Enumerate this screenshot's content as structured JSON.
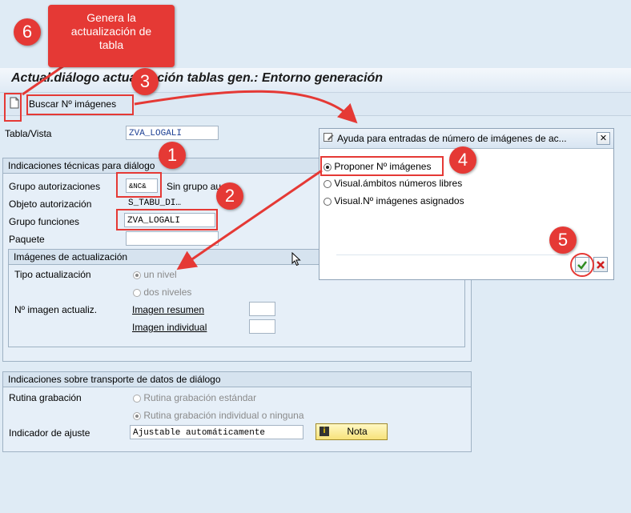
{
  "title": "Actual.diálogo actualización tablas gen.: Entorno generación",
  "toolbar": {
    "search_label": "Buscar Nº imágenes"
  },
  "table_view": {
    "label": "Tabla/Vista",
    "value": "ZVA_LOGALI"
  },
  "tech_group": {
    "header": "Indicaciones técnicas para diálogo",
    "auth_group_label": "Grupo autorizaciones",
    "auth_group_value": "&NC&",
    "auth_group_text": "Sin grupo au",
    "auth_object_label": "Objeto autorización",
    "auth_object_value": "S_TABU_DI…",
    "func_group_label": "Grupo funciones",
    "func_group_value": "ZVA_LOGALI",
    "package_label": "Paquete"
  },
  "images_group": {
    "header": "Imágenes de actualización",
    "type_label": "Tipo actualización",
    "one_level": "un nivel",
    "two_levels": "dos niveles",
    "number_label": "Nº imagen actualiz.",
    "summary_label": "Imagen resumen",
    "individual_label": "Imagen individual"
  },
  "transport_group": {
    "header": "Indicaciones sobre transporte de datos de diálogo",
    "routine_label": "Rutina grabación",
    "routine_standard": "Rutina grabación estándar",
    "routine_individual": "Rutina grabación individual o ninguna",
    "adjust_label": "Indicador de ajuste",
    "adjust_value": "Ajustable automáticamente",
    "note_button": "Nota"
  },
  "dialog": {
    "title": "Ayuda para entradas de número de imágenes de ac...",
    "options": [
      "Proponer Nº imágenes",
      "Visual.ámbitos números libres",
      "Visual.Nº imágenes asignados"
    ]
  },
  "callout": {
    "text_line1": "Genera la",
    "text_line2": "actualización de",
    "text_line3": "tabla"
  },
  "markers": [
    "1",
    "2",
    "3",
    "4",
    "5",
    "6"
  ],
  "colors": {
    "accent_red": "#e53935",
    "field_text": "#1c3f94",
    "background": "#dfebf5"
  }
}
